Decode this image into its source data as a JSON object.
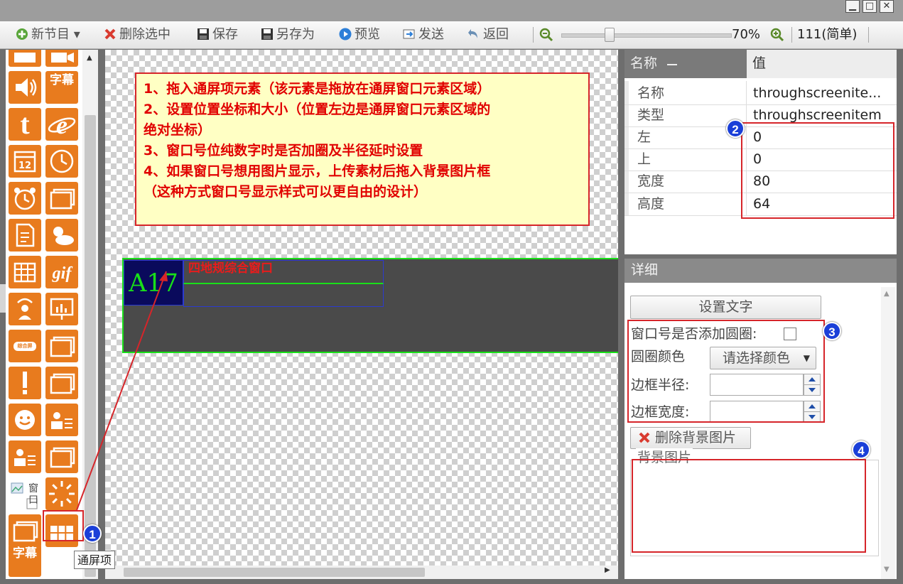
{
  "toolbar": {
    "new_program": "新节目",
    "delete_selected": "删除选中",
    "save": "保存",
    "save_as": "另存为",
    "preview": "预览",
    "send": "发送",
    "back": "返回",
    "zoom": "70%",
    "program_name": "111(简单)"
  },
  "annotation": {
    "lines": [
      "1、拖入通屏项元素（该元素是拖放在通屏窗口元素区域）",
      "2、设置位置坐标和大小（位置左边是通屏窗口元素区域的",
      "绝对坐标）",
      "3、窗口号位纯数字时是否加圈及半径延时设置",
      "4、如果窗口号想用图片显示，上传素材后拖入背景图片框",
      "（这种方式窗口号显示样式可以更自由的设计）"
    ]
  },
  "canvas": {
    "window_number": "A17",
    "window_title": "四地规综合窗口"
  },
  "palette": {
    "tile_subtitle": "字幕",
    "tile_t": "t",
    "tile_12": "12",
    "tile_zonghe": "综合屏",
    "tile_broken": "窗口",
    "tooltip": "通屏项"
  },
  "props": {
    "header_name": "名称",
    "header_value": "值",
    "rows": [
      {
        "name": "名称",
        "value": "throughscreenite..."
      },
      {
        "name": "类型",
        "value": "throughscreenitem"
      },
      {
        "name": "左",
        "value": "0"
      },
      {
        "name": "上",
        "value": "0"
      },
      {
        "name": "宽度",
        "value": "80"
      },
      {
        "name": "高度",
        "value": "64"
      }
    ]
  },
  "detail": {
    "title": "详细",
    "set_text_button": "设置文字",
    "add_circle_label": "窗口号是否添加圆圈:",
    "circle_color_label": "圆圈颜色",
    "color_select": "请选择颜色",
    "border_radius_label": "边框半径:",
    "border_width_label": "边框宽度:",
    "delete_bg_button": "删除背景图片",
    "bg_image_label": "背景图片"
  },
  "badges": [
    "1",
    "2",
    "3",
    "4"
  ],
  "colors": {
    "accent_orange": "#e87b1e",
    "callout_red": "#d6252a",
    "badge_blue": "#1a3fd8",
    "window_green": "#19e019"
  }
}
